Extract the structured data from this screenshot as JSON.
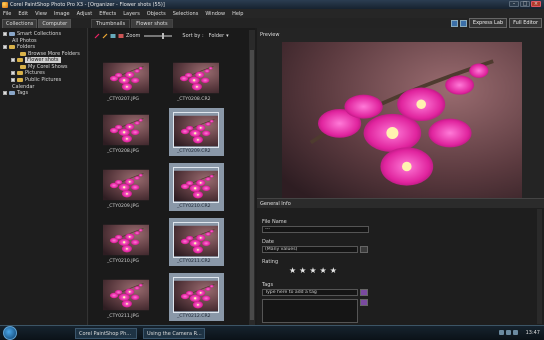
{
  "window": {
    "title": "Corel PaintShop Photo Pro X3 - [Organizer - Flower shots (55)]"
  },
  "menu": [
    "File",
    "Edit",
    "View",
    "Image",
    "Adjust",
    "Effects",
    "Layers",
    "Objects",
    "Selections",
    "Window",
    "Help"
  ],
  "left_tabs": [
    "Collections",
    "Computer"
  ],
  "browse_tabs": [
    "Thumbnails",
    "Flower shots"
  ],
  "top_right": {
    "express_lab": "Express Lab",
    "full_editor": "Full Editor"
  },
  "tree": [
    {
      "label": "Smart Collections"
    },
    {
      "label": "All Photos"
    },
    {
      "label": "Folders"
    },
    {
      "label": "Browse More Folders"
    },
    {
      "label": "Flower shots",
      "selected": true
    },
    {
      "label": "My Corel Shows"
    },
    {
      "label": "Pictures"
    },
    {
      "label": "Public Pictures"
    },
    {
      "label": "Calendar"
    },
    {
      "label": "Tags"
    }
  ],
  "thumb_toolbar": {
    "zoom_label": "Zoom",
    "sort_label": "Sort by :",
    "sort_value": "Folder"
  },
  "thumbnails": [
    {
      "name": "_CTY0207.JPG",
      "selected": false
    },
    {
      "name": "_CTY0208.CR2",
      "selected": false
    },
    {
      "name": "_CTY0208.JPG",
      "selected": false
    },
    {
      "name": "_CTY0209.CR2",
      "selected": true
    },
    {
      "name": "_CTY0209.JPG",
      "selected": false
    },
    {
      "name": "_CTY0210.CR2",
      "selected": true
    },
    {
      "name": "_CTY0210.JPG",
      "selected": false
    },
    {
      "name": "_CTY0211.CR2",
      "selected": true
    },
    {
      "name": "_CTY0211.JPG",
      "selected": false
    },
    {
      "name": "_CTY0212.CR2",
      "selected": true
    }
  ],
  "preview": {
    "header": "Preview"
  },
  "info": {
    "header": "General Info",
    "filename_label": "File Name",
    "filename_value": "---",
    "date_label": "Date",
    "date_value": "(Many values)",
    "rating_label": "Rating",
    "rating_stars": 5,
    "tags_label": "Tags",
    "tags_placeholder": "Type here to add a tag"
  },
  "taskbar": {
    "items": [
      "Corel PaintShop Ph...",
      "Using the Camera R..."
    ],
    "clock": "13:47"
  }
}
